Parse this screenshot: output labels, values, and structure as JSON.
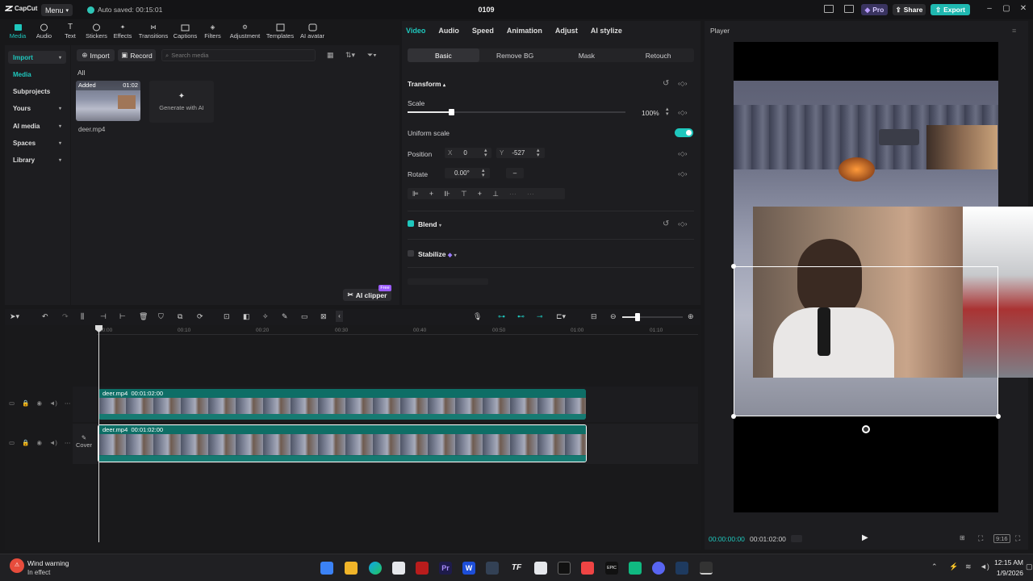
{
  "titlebar": {
    "app_name": "CapCut",
    "menu_label": "Menu",
    "autosave_text": "Auto saved: 00:15:01",
    "project_title": "0109",
    "pro_label": "Pro",
    "share_label": "Share",
    "export_label": "Export"
  },
  "tool_tabs": [
    {
      "label": "Media",
      "icon": "media-icon",
      "active": true
    },
    {
      "label": "Audio",
      "icon": "audio-icon"
    },
    {
      "label": "Text",
      "icon": "text-icon"
    },
    {
      "label": "Stickers",
      "icon": "sticker-icon"
    },
    {
      "label": "Effects",
      "icon": "effects-icon"
    },
    {
      "label": "Transitions",
      "icon": "transitions-icon"
    },
    {
      "label": "Captions",
      "icon": "captions-icon"
    },
    {
      "label": "Filters",
      "icon": "filters-icon"
    },
    {
      "label": "Adjustment",
      "icon": "adjustment-icon"
    },
    {
      "label": "Templates",
      "icon": "templates-icon"
    },
    {
      "label": "AI avatar",
      "icon": "ai-avatar-icon"
    }
  ],
  "side_nav": {
    "items": [
      "Import",
      "Media",
      "Subprojects",
      "Yours",
      "AI media",
      "Spaces",
      "Library"
    ]
  },
  "media": {
    "import_label": "Import",
    "record_label": "Record",
    "search_placeholder": "Search media",
    "all_label": "All",
    "clip_badge": "Added",
    "clip_duration": "01:02",
    "clip_name": "deer.mp4",
    "generate_label": "Generate with AI",
    "ai_clipper_label": "AI clipper",
    "free_badge": "Free"
  },
  "properties": {
    "tabs": [
      "Video",
      "Audio",
      "Speed",
      "Animation",
      "Adjust",
      "AI stylize"
    ],
    "sub_tabs": [
      "Basic",
      "Remove BG",
      "Mask",
      "Retouch"
    ],
    "transform_label": "Transform",
    "scale_label": "Scale",
    "scale_value": "100%",
    "uniform_scale_label": "Uniform scale",
    "position_label": "Position",
    "x_label": "X",
    "x_value": "0",
    "y_label": "Y",
    "y_value": "-527",
    "rotate_label": "Rotate",
    "rotate_value": "0.00°",
    "blend_label": "Blend",
    "stabilize_label": "Stabilize",
    "accent_color": "#1fc7bd"
  },
  "player": {
    "title": "Player",
    "current_time": "00:00:00:00",
    "duration": "00:01:02:00"
  },
  "timeline": {
    "ruler_ticks": [
      "00:00",
      "00:10",
      "00:20",
      "00:30",
      "00:40",
      "00:50",
      "01:00",
      "01:10"
    ],
    "cover_label": "Cover",
    "clips": [
      {
        "name": "deer.mp4",
        "duration": "00:01:02:00"
      },
      {
        "name": "deer.mp4",
        "duration": "00:01:02:00"
      }
    ]
  },
  "taskbar": {
    "weather_title": "Wind warning",
    "weather_sub": "In effect",
    "time": "12:15 AM",
    "date": "1/9/2026"
  }
}
